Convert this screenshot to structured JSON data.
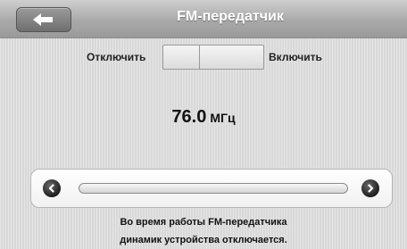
{
  "header": {
    "title": "FM-передатчик",
    "back_icon": "back-arrow-icon"
  },
  "toggle": {
    "off_label": "Отключить",
    "on_label": "Включить"
  },
  "frequency": {
    "value": "76.0",
    "unit": "МГц"
  },
  "slider": {
    "left_icon": "chevron-left-icon",
    "right_icon": "chevron-right-icon"
  },
  "notice": {
    "line1": "Во время работы FM-передатчика",
    "line2": "динамик устройства отключается."
  }
}
